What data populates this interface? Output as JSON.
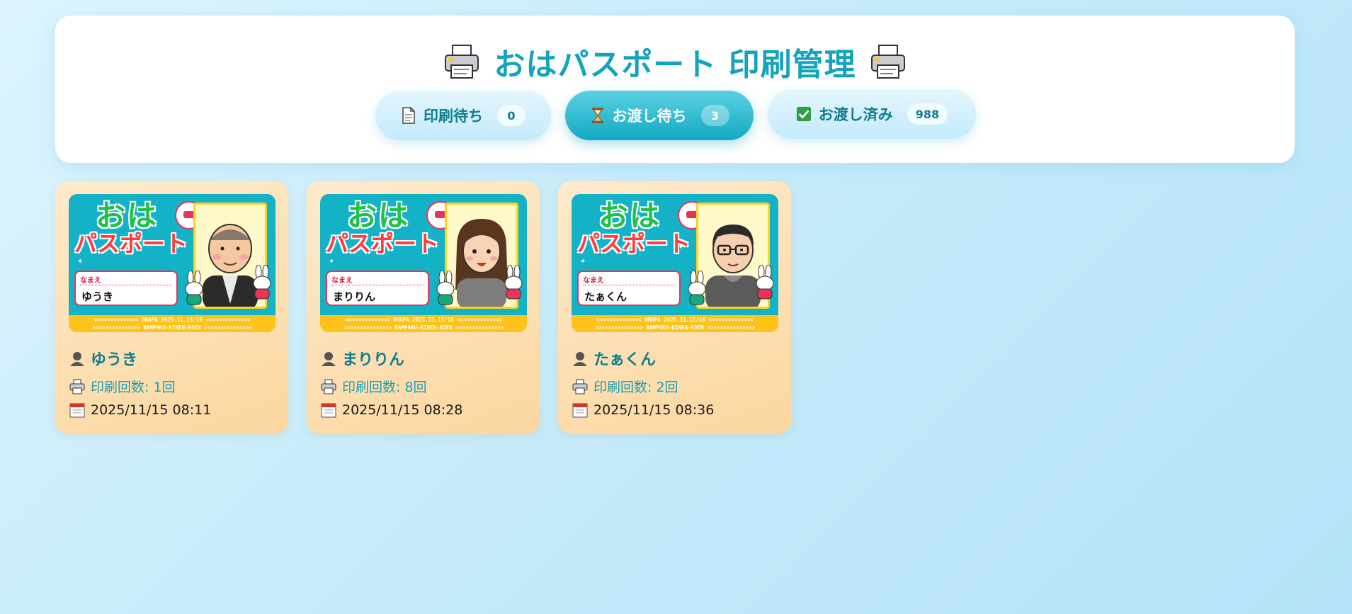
{
  "header": {
    "title": "おはパスポート 印刷管理",
    "title_icon": "printer-icon"
  },
  "tabs": [
    {
      "icon": "document-icon",
      "label": "印刷待ち",
      "count": "0",
      "active": false
    },
    {
      "icon": "hourglass-icon",
      "label": "お渡し待ち",
      "count": "3",
      "active": true
    },
    {
      "icon": "checkmark-icon",
      "label": "お渡し済み",
      "count": "988",
      "active": false
    }
  ],
  "passport_template": {
    "logo_line1": "おは",
    "logo_line2": "パスポート",
    "name_label": "なまえ",
    "strip_line1": "<<<<<<<<<<<<<< OHAPA  2025.11.15/16 <<<<<<<<<<<<<<",
    "strip_line2": ">>>>>>>>>>>>>>> BAMPAKU-KINEN-KOEN >>>>>>>>>>>>>>>"
  },
  "cards": [
    {
      "name": "ゆうき",
      "print_count": "印刷回数: 1回",
      "date": "2025/11/15 08:11",
      "avatar": "man-bald-avatar"
    },
    {
      "name": "まりりん",
      "print_count": "印刷回数: 8回",
      "date": "2025/11/15 08:28",
      "avatar": "woman-brown-hair-avatar"
    },
    {
      "name": "たぁくん",
      "print_count": "印刷回数: 2回",
      "date": "2025/11/15 08:36",
      "avatar": "man-glasses-avatar"
    }
  ],
  "colors": {
    "accent": "#14a3bd",
    "active_tab": "#12a9c3",
    "card_bg": "#fcd79f"
  }
}
